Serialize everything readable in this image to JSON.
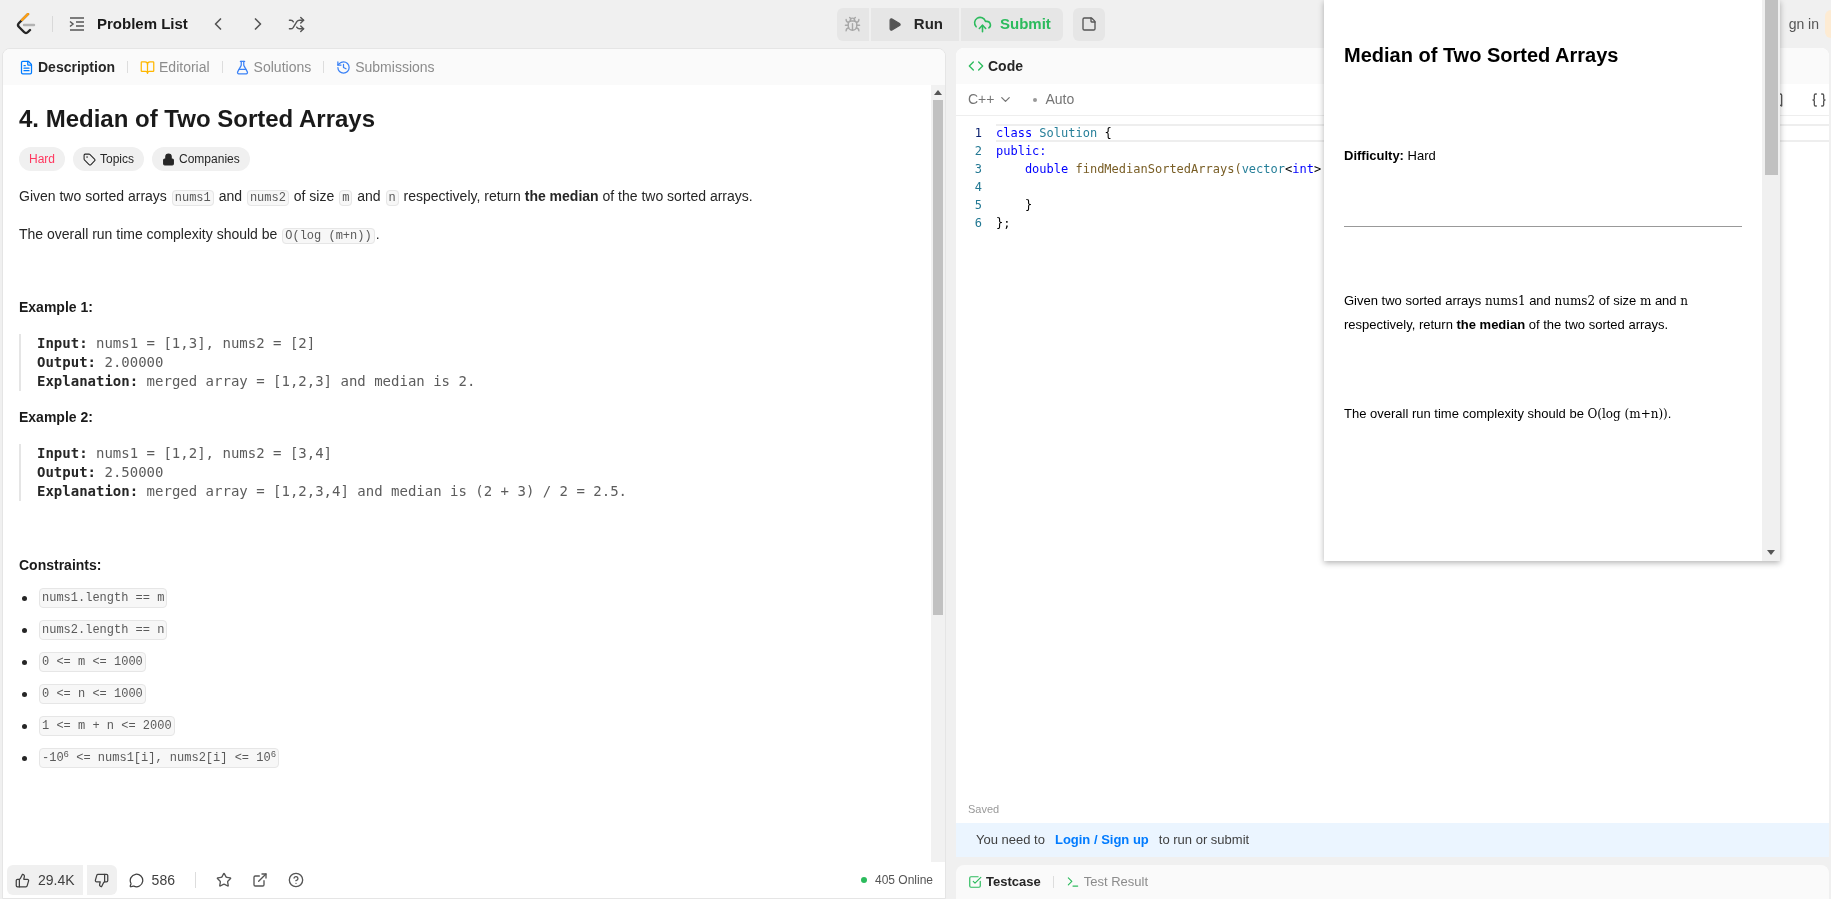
{
  "top_bar": {
    "problem_list": "Problem List",
    "run": "Run",
    "submit": "Submit",
    "sign_in": "gn in"
  },
  "description_panel": {
    "tabs": [
      {
        "label": "Description",
        "kind": "description",
        "selected": true
      },
      {
        "label": "Editorial",
        "kind": "editorial",
        "selected": false
      },
      {
        "label": "Solutions",
        "kind": "solutions",
        "selected": false
      },
      {
        "label": "Submissions",
        "kind": "submissions",
        "selected": false
      }
    ],
    "title": "4. Median of Two Sorted Arrays",
    "tags": [
      {
        "label": "Hard",
        "kind": "difficulty"
      },
      {
        "label": "Topics",
        "kind": "topics"
      },
      {
        "label": "Companies",
        "kind": "companies"
      }
    ],
    "paragraphs": [
      [
        {
          "kind": "text",
          "text": "Given two sorted arrays "
        },
        {
          "kind": "code",
          "text": "nums1"
        },
        {
          "kind": "text",
          "text": " and "
        },
        {
          "kind": "code",
          "text": "nums2"
        },
        {
          "kind": "text",
          "text": " of size "
        },
        {
          "kind": "code",
          "text": "m"
        },
        {
          "kind": "text",
          "text": " and "
        },
        {
          "kind": "code",
          "text": "n"
        },
        {
          "kind": "text",
          "text": " respectively, return "
        },
        {
          "kind": "bold",
          "text": "the median"
        },
        {
          "kind": "text",
          "text": " of the two sorted arrays."
        }
      ],
      [
        {
          "kind": "text",
          "text": "The overall run time complexity should be "
        },
        {
          "kind": "code",
          "text": "O(log (m+n))"
        },
        {
          "kind": "text",
          "text": "."
        }
      ]
    ],
    "examples": [
      {
        "heading": "Example 1:",
        "lines": [
          {
            "label": "Input:",
            "value": "nums1 = [1,3], nums2 = [2]"
          },
          {
            "label": "Output:",
            "value": "2.00000"
          },
          {
            "label": "Explanation:",
            "value": "merged array = [1,2,3] and median is 2."
          }
        ]
      },
      {
        "heading": "Example 2:",
        "lines": [
          {
            "label": "Input:",
            "value": "nums1 = [1,2], nums2 = [3,4]"
          },
          {
            "label": "Output:",
            "value": "2.50000"
          },
          {
            "label": "Explanation:",
            "value": "merged array = [1,2,3,4] and median is (2 + 3) / 2 = 2.5."
          }
        ]
      }
    ],
    "constraints_heading": "Constraints:",
    "constraints": [
      "nums1.length == m",
      "nums2.length == n",
      "0 <= m <= 1000",
      "0 <= n <= 1000",
      "1 <= m + n <= 2000",
      "-10$^{6}$ <= nums1[i], nums2[i] <= 10$^{6}$"
    ],
    "footer": {
      "likes": "29.4K",
      "comments": "586",
      "online": "405 Online"
    }
  },
  "code_panel": {
    "title": "Code",
    "language": "C++",
    "mode": "Auto",
    "lines": [
      {
        "number": "1",
        "current": true,
        "tokens": [
          {
            "kind": "keyword",
            "text": "class"
          },
          {
            "kind": "type",
            "text": " Solution"
          },
          {
            "kind": "plain",
            "text": " {"
          }
        ]
      },
      {
        "number": "2",
        "current": false,
        "tokens": [
          {
            "kind": "keyword",
            "text": "public:"
          }
        ]
      },
      {
        "number": "3",
        "current": false,
        "tokens": [
          {
            "kind": "keyword",
            "text": "    double"
          },
          {
            "kind": "function",
            "text": " findMedianSortedArrays("
          },
          {
            "kind": "type",
            "text": "vector"
          },
          {
            "kind": "plain",
            "text": "<"
          },
          {
            "kind": "keyword",
            "text": "int"
          },
          {
            "kind": "plain",
            "text": ">"
          }
        ]
      },
      {
        "number": "4",
        "current": false
      },
      {
        "number": "5",
        "current": false,
        "tokens": [
          {
            "kind": "plain",
            "text": "    }"
          }
        ]
      },
      {
        "number": "6",
        "current": false,
        "tokens": [
          {
            "kind": "plain",
            "text": "};"
          }
        ]
      }
    ],
    "status": "Saved",
    "notice": {
      "before": "You need to",
      "link": "Login / Sign up",
      "after": "to run or submit"
    }
  },
  "bottom_tabs": [
    {
      "label": "Testcase",
      "kind": "testcase"
    },
    {
      "label": "Test Result",
      "kind": "result"
    }
  ],
  "popup": {
    "title": "Median of Two Sorted Arrays",
    "difficulty": "**Difficulty:** Hard",
    "paragraphs": [
      [
        {
          "kind": "text",
          "text": "Given two sorted arrays "
        },
        {
          "kind": "code",
          "text": "nums1"
        },
        {
          "kind": "text",
          "text": " and "
        },
        {
          "kind": "code",
          "text": "nums2"
        },
        {
          "kind": "text",
          "text": " of size "
        },
        {
          "kind": "code",
          "text": "m"
        },
        {
          "kind": "text",
          "text": " and "
        },
        {
          "kind": "code",
          "text": "n"
        },
        {
          "kind": "text",
          "text": " respectively, return "
        },
        {
          "kind": "bold",
          "text": "the median"
        },
        {
          "kind": "text",
          "text": " of the two sorted arrays."
        }
      ],
      [
        {
          "kind": "text",
          "text": "The overall run time complexity should be "
        },
        {
          "kind": "code",
          "text": "O(log (m+n))"
        },
        {
          "kind": "text",
          "text": "."
        }
      ]
    ]
  }
}
